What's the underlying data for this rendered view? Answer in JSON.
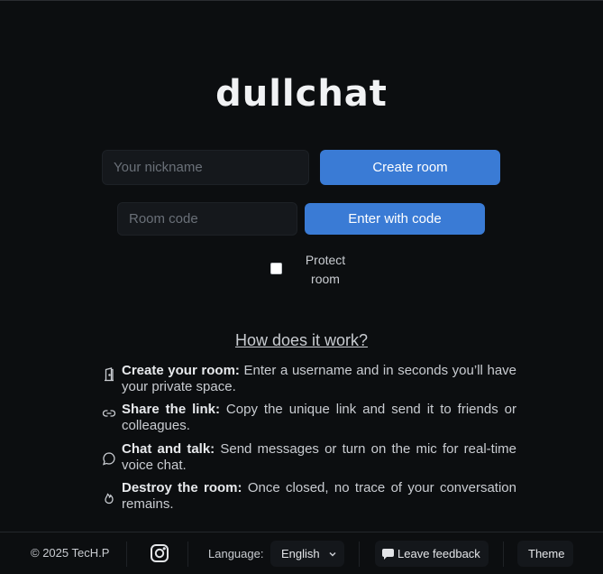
{
  "app": {
    "title": "dullchat"
  },
  "create": {
    "nickname_placeholder": "Your nickname",
    "button": "Create room"
  },
  "join": {
    "code_placeholder": "Room code",
    "button": "Enter with code"
  },
  "protect": {
    "label": "Protect room",
    "checked": false
  },
  "how": {
    "heading": "How does it work?",
    "items": [
      {
        "icon": "door-icon",
        "title": "Create your room:",
        "text": " Enter a username and in seconds you’ll have your private space."
      },
      {
        "icon": "link-icon",
        "title": "Share the link:",
        "text": " Copy the unique link and send it to friends or colleagues."
      },
      {
        "icon": "chat-bubble-icon",
        "title": "Chat and talk:",
        "text": " Send messages or turn on the mic for real-time voice chat."
      },
      {
        "icon": "flame-icon",
        "title": "Destroy the room:",
        "text": " Once closed, no trace of your conversation remains."
      }
    ]
  },
  "footer": {
    "copyright": "© 2025 TecH.P",
    "instagram_icon": "instagram-icon",
    "language_label": "Language:",
    "language_value": "English",
    "feedback": "Leave feedback",
    "theme": "Theme"
  }
}
